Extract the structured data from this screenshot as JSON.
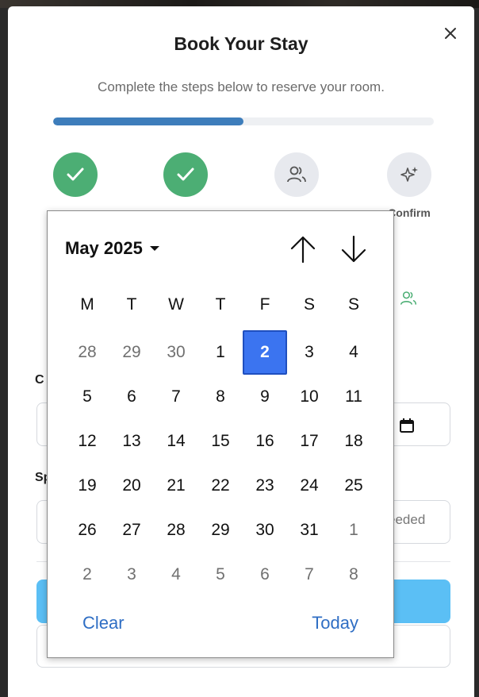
{
  "modal": {
    "title": "Book Your Stay",
    "subtitle": "Complete the steps below to reserve your room.",
    "progress_fraction": 0.5,
    "steps": [
      {
        "label": "",
        "status": "done",
        "icon": "check-icon"
      },
      {
        "label": "",
        "status": "done",
        "icon": "check-icon"
      },
      {
        "label": "",
        "status": "pending",
        "icon": "users-icon"
      },
      {
        "label": "Confirm",
        "status": "pending",
        "icon": "sparkles-icon"
      }
    ],
    "label_fragment_1": "C",
    "label_fragment_2": "Sp",
    "partial_placeholder": "eeded",
    "colors": {
      "accent": "#3d7dbb",
      "done": "#4cae74",
      "primary_button": "#5bbff5"
    }
  },
  "datepicker": {
    "month_label": "May 2025",
    "weekdays": [
      "M",
      "T",
      "W",
      "T",
      "F",
      "S",
      "S"
    ],
    "days": [
      {
        "d": "28",
        "other": true
      },
      {
        "d": "29",
        "other": true
      },
      {
        "d": "30",
        "other": true
      },
      {
        "d": "1"
      },
      {
        "d": "2",
        "selected": true
      },
      {
        "d": "3"
      },
      {
        "d": "4"
      },
      {
        "d": "5"
      },
      {
        "d": "6"
      },
      {
        "d": "7"
      },
      {
        "d": "8"
      },
      {
        "d": "9"
      },
      {
        "d": "10"
      },
      {
        "d": "11"
      },
      {
        "d": "12"
      },
      {
        "d": "13"
      },
      {
        "d": "14"
      },
      {
        "d": "15"
      },
      {
        "d": "16"
      },
      {
        "d": "17"
      },
      {
        "d": "18"
      },
      {
        "d": "19"
      },
      {
        "d": "20"
      },
      {
        "d": "21"
      },
      {
        "d": "22"
      },
      {
        "d": "23"
      },
      {
        "d": "24"
      },
      {
        "d": "25"
      },
      {
        "d": "26"
      },
      {
        "d": "27"
      },
      {
        "d": "28"
      },
      {
        "d": "29"
      },
      {
        "d": "30"
      },
      {
        "d": "31"
      },
      {
        "d": "1",
        "other": true
      },
      {
        "d": "2",
        "other": true
      },
      {
        "d": "3",
        "other": true
      },
      {
        "d": "4",
        "other": true
      },
      {
        "d": "5",
        "other": true
      },
      {
        "d": "6",
        "other": true
      },
      {
        "d": "7",
        "other": true
      },
      {
        "d": "8",
        "other": true
      }
    ],
    "clear_label": "Clear",
    "today_label": "Today",
    "selected_color": "#3b74f0"
  }
}
